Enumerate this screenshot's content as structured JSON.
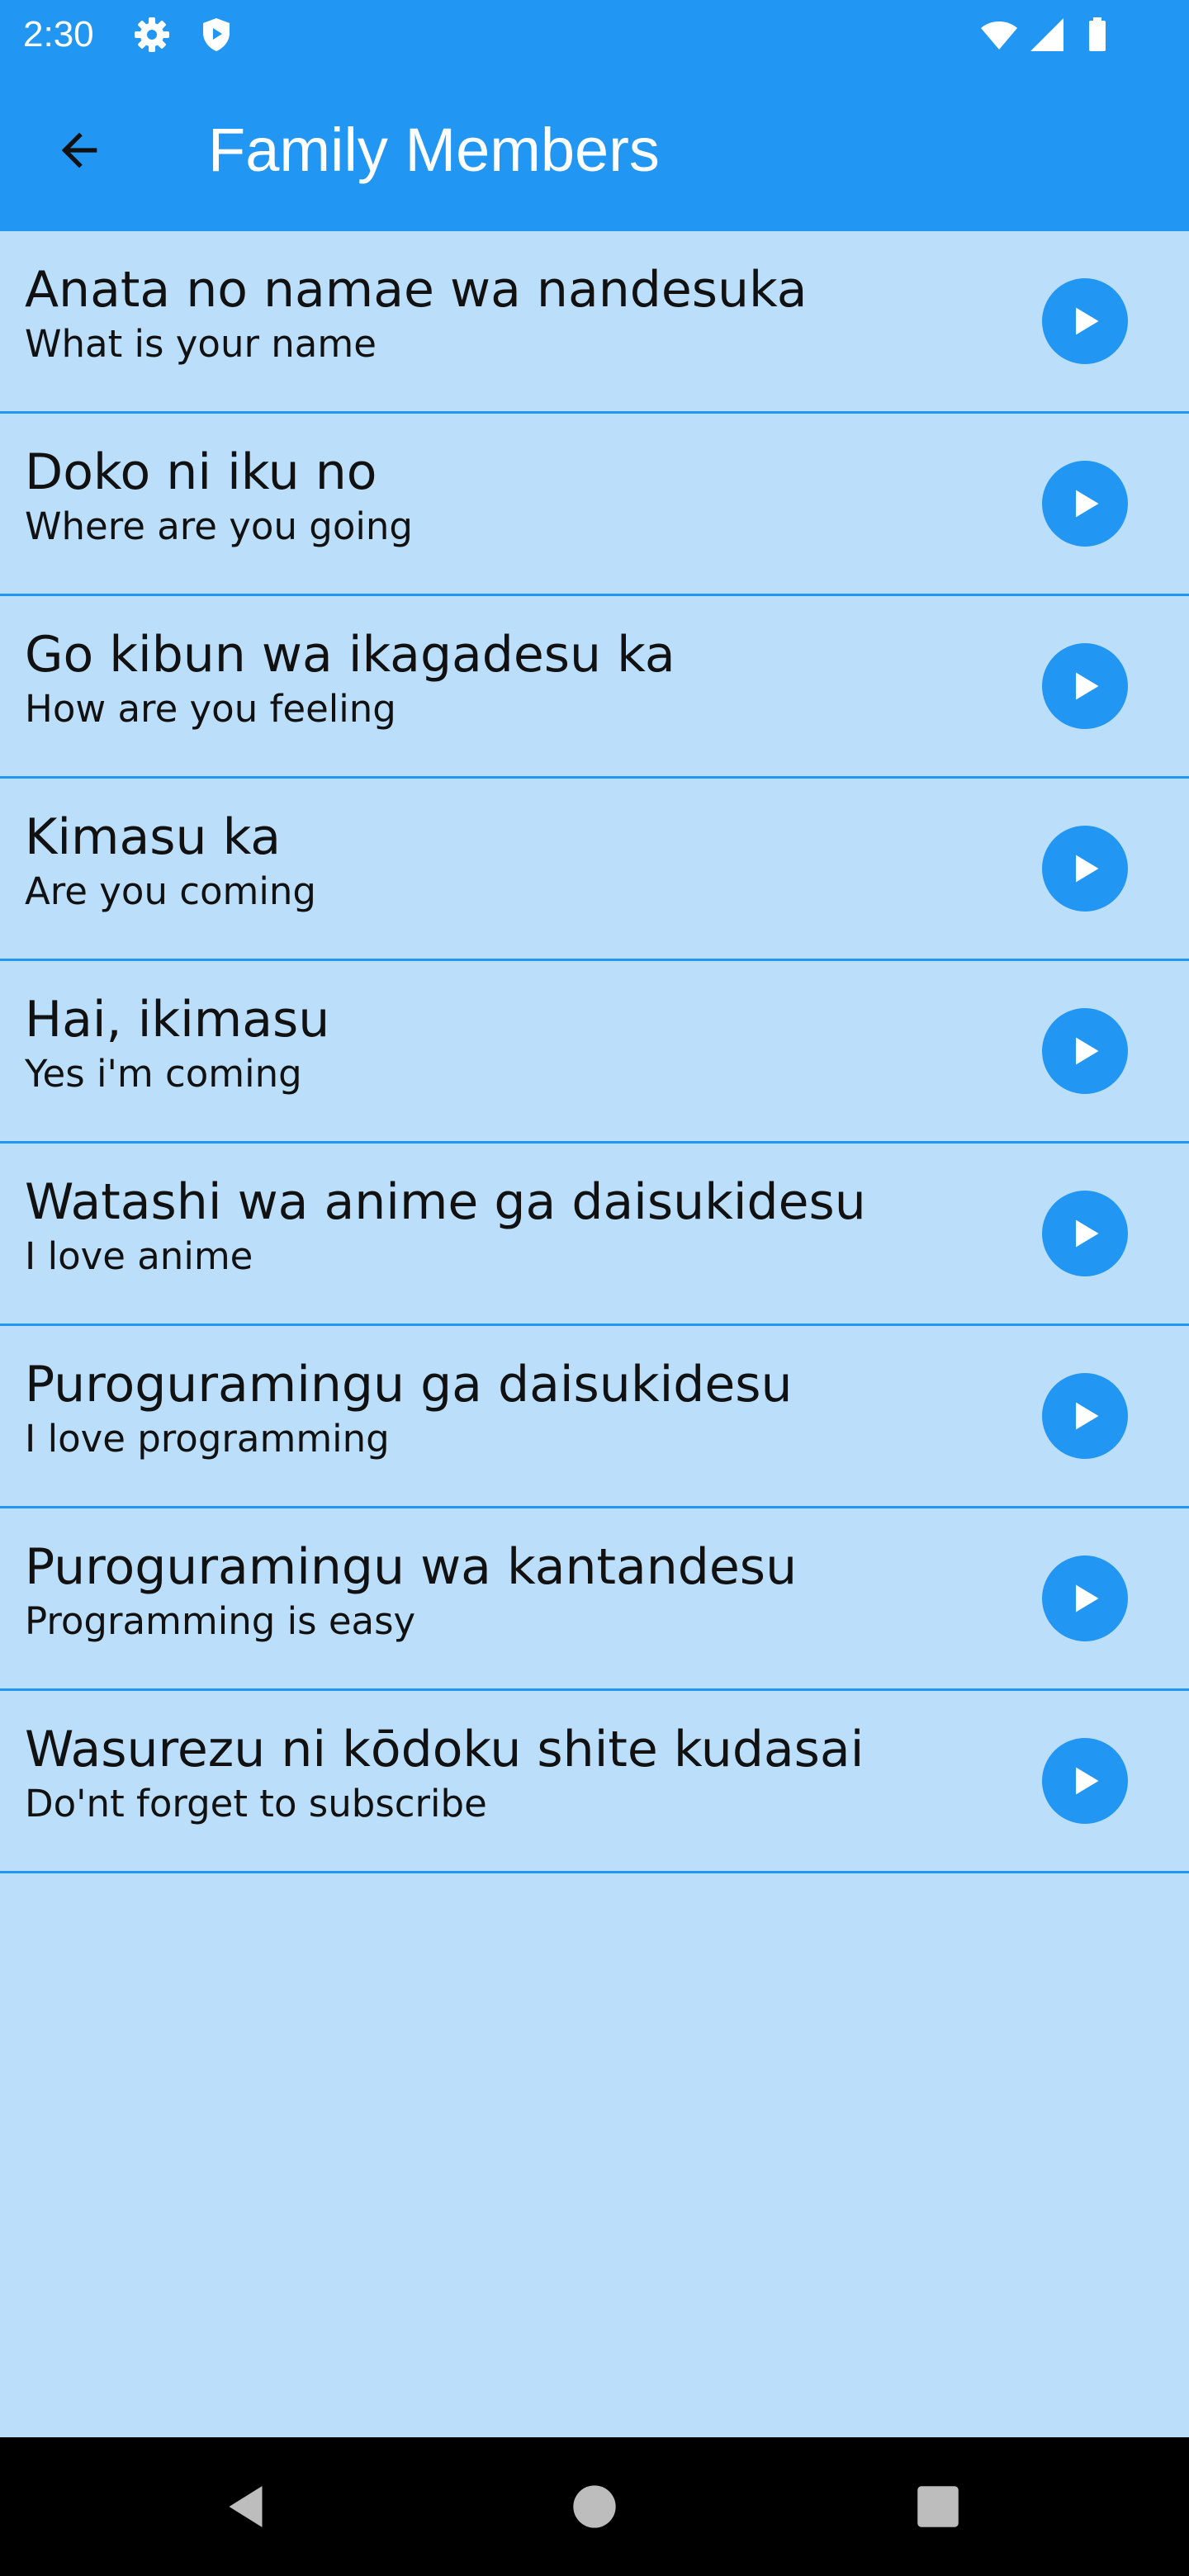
{
  "status_bar": {
    "time": "2:30",
    "icons": [
      "gear-icon",
      "shield-icon",
      "wifi-icon",
      "signal-icon",
      "battery-icon"
    ]
  },
  "app_bar": {
    "back_icon": "arrow-left-icon",
    "title": "Family Members"
  },
  "phrases": [
    {
      "primary": "Anata no namae wa nandesuka",
      "secondary": "What is your name"
    },
    {
      "primary": "Doko ni iku no",
      "secondary": "Where are you going"
    },
    {
      "primary": "Go kibun wa ikagadesu ka",
      "secondary": "How are you feeling"
    },
    {
      "primary": "Kimasu ka",
      "secondary": "Are you coming"
    },
    {
      "primary": "Hai, ikimasu",
      "secondary": "Yes i'm coming"
    },
    {
      "primary": "Watashi wa anime ga daisukidesu",
      "secondary": "I love anime"
    },
    {
      "primary": "Puroguramingu ga daisukidesu",
      "secondary": "I love programming"
    },
    {
      "primary": "Puroguramingu wa kantandesu",
      "secondary": "Programming is easy"
    },
    {
      "primary": "Wasurezu ni kōdoku shite kudasai",
      "secondary": "Do'nt forget to subscribe"
    }
  ],
  "row_icon": "play-icon",
  "nav_bar": {
    "icons": [
      "back-triangle-icon",
      "home-circle-icon",
      "recents-square-icon"
    ]
  },
  "colors": {
    "primary": "#2196F3",
    "background": "#BBDEFB",
    "nav_bar": "#000000",
    "text": "#111111"
  }
}
